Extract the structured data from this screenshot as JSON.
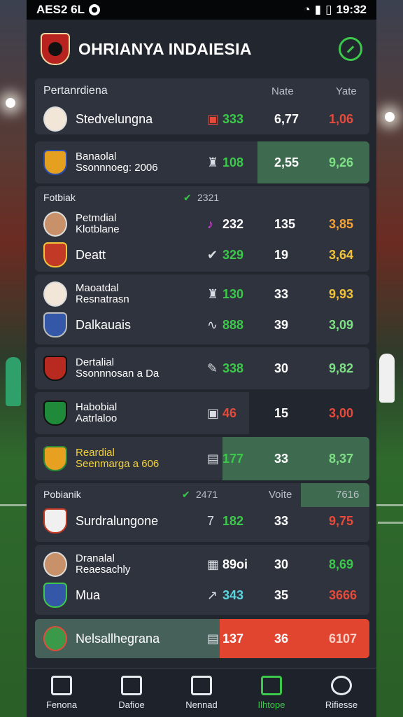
{
  "status_bar": {
    "left_text": "AES2 6L",
    "time": "19:32"
  },
  "header": {
    "title": "OHRIANYA INDAIESIA"
  },
  "card1": {
    "title": "Pertanrdiena",
    "col2": "Nate",
    "col3": "Yate",
    "rows": [
      {
        "name": "Stedvelungna",
        "v1": "333",
        "v2": "6,77",
        "v3": "1,06"
      }
    ]
  },
  "card2": {
    "rows": [
      {
        "name_line1": "Banaolal",
        "name_line2": "Ssonnnoeg: 2006",
        "v1": "108",
        "v2": "2,55",
        "v3": "9,26"
      }
    ]
  },
  "card3": {
    "title": "Fotbiak",
    "num": "2321",
    "rows": [
      {
        "name_line1": "Petmdial",
        "name_line2": "Klotblane",
        "v1": "232",
        "v2": "135",
        "v3": "3,85"
      },
      {
        "name": "Deatt",
        "v1": "329",
        "v2": "19",
        "v3": "3,64"
      }
    ]
  },
  "card4": {
    "rows": [
      {
        "name_line1": "Maoatdal",
        "name_line2": "Resnatrasn",
        "v1": "130",
        "v2": "33",
        "v3": "9,93"
      },
      {
        "name": "Dalkauais",
        "v1": "888",
        "v2": "39",
        "v3": "3,09"
      }
    ]
  },
  "card5": {
    "rows": [
      {
        "name_line1": "Dertalial",
        "name_line2": "Ssonnnosan a Da",
        "v1": "338",
        "v2": "30",
        "v3": "9,82"
      }
    ]
  },
  "card6": {
    "rows": [
      {
        "name_line1": "Habobial",
        "name_line2": "Aatrlaloo",
        "v1": "46",
        "v2": "15",
        "v3": "3,00"
      }
    ]
  },
  "card7": {
    "rows": [
      {
        "name_line1": "Reardial",
        "name_line2": "Seenmarga a 606",
        "v1": "177",
        "v2": "33",
        "v3": "8,37"
      }
    ]
  },
  "card8": {
    "title": "Pobianik",
    "num": "2471",
    "col2": "Voite",
    "col3": "7616",
    "rows": [
      {
        "name": "Surdralungone",
        "v1": "182",
        "v2": "33",
        "v3": "9,75"
      }
    ]
  },
  "card9": {
    "rows": [
      {
        "name_line1": "Dranalal",
        "name_line2": "Reaesachly",
        "v1": "89oi",
        "v2": "30",
        "v3": "8,69"
      },
      {
        "name": "Mua",
        "v1": "343",
        "v2": "35",
        "v3": "3666"
      }
    ]
  },
  "card10": {
    "rows": [
      {
        "name": "Nelsallhegrana",
        "v1": "137",
        "v2": "36",
        "v3": "6107"
      }
    ]
  },
  "nav": {
    "items": [
      {
        "label": "Fenona",
        "icon": "home-icon"
      },
      {
        "label": "Dafioe",
        "icon": "chat-icon"
      },
      {
        "label": "Nennad",
        "icon": "search-icon"
      },
      {
        "label": "Ilhtope",
        "icon": "stats-icon"
      },
      {
        "label": "Rifiesse",
        "icon": "profile-icon"
      }
    ],
    "active_index": 3
  },
  "colors": {
    "accent": "#3cc84a",
    "alert": "#e54a3a",
    "panel": "#22262f",
    "card": "#2f333d"
  }
}
